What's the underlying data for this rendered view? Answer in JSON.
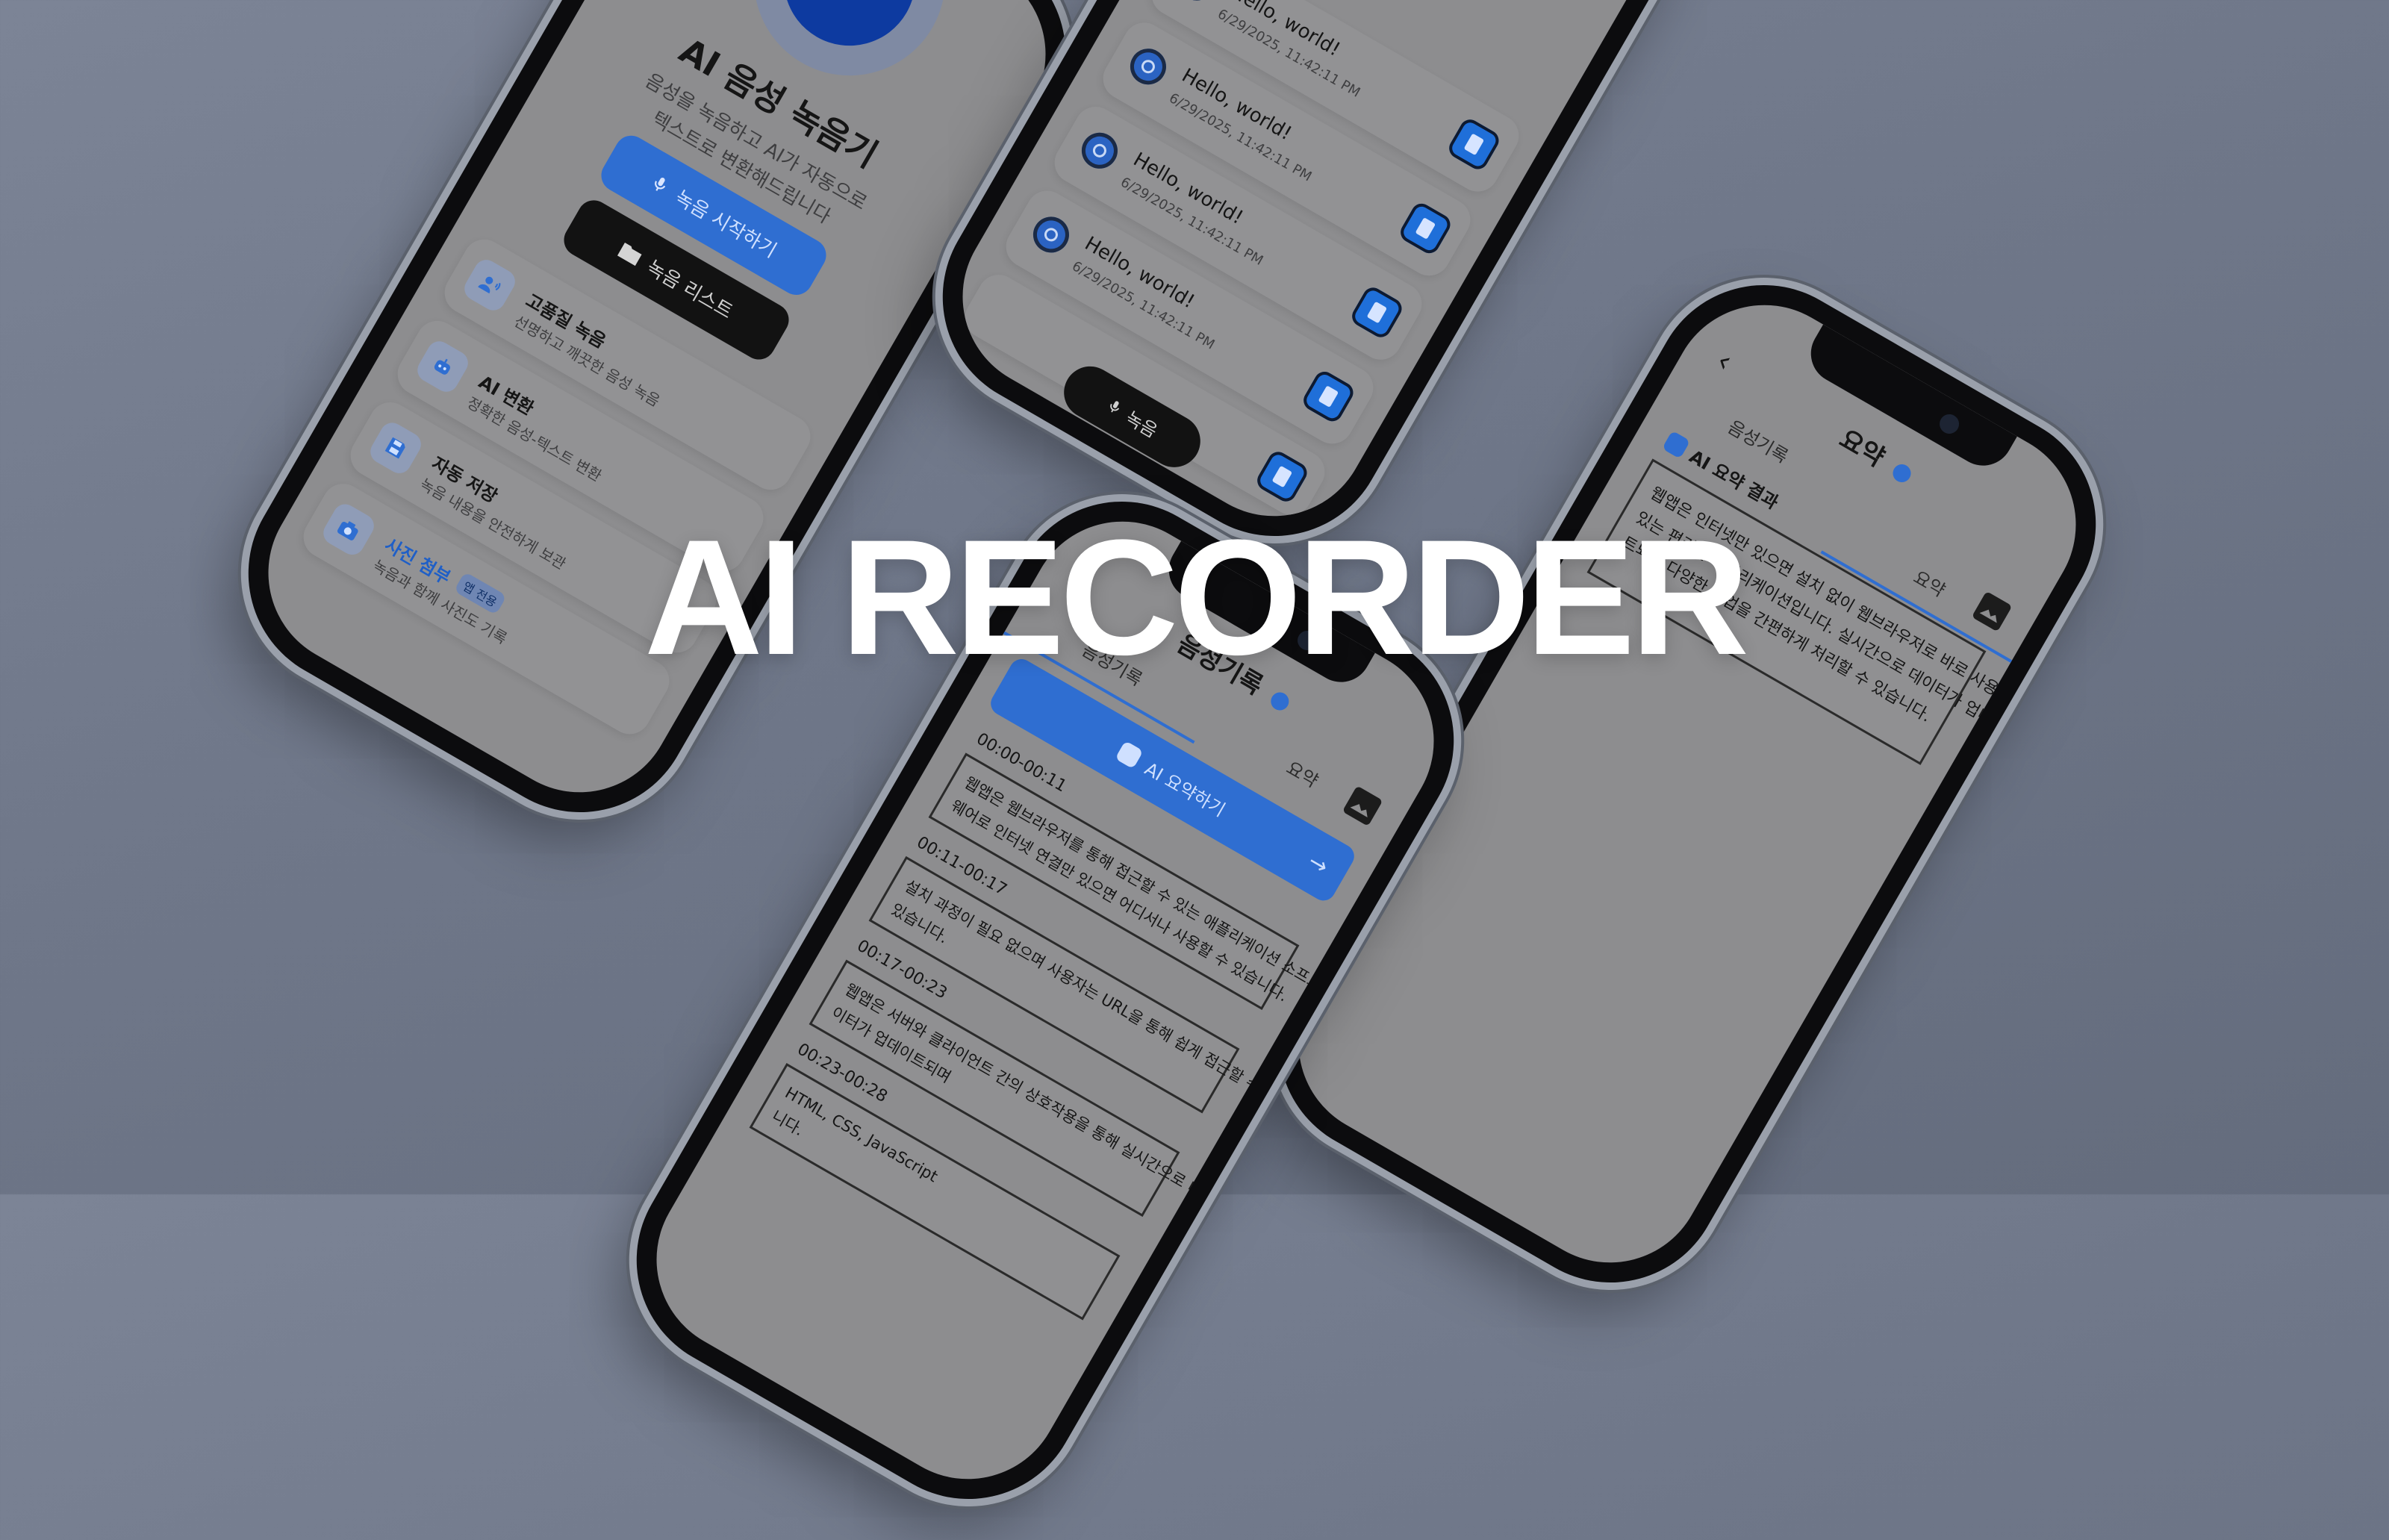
{
  "hero": {
    "title": "AI RECORDER"
  },
  "home": {
    "app_title": "AI 음성 녹음기",
    "subtitle_line1": "음성을 녹음하고 AI가 자동으로",
    "subtitle_line2": "텍스트로 변환해드립니다",
    "start_label": "녹음 시작하기",
    "list_label": "녹음 리스트",
    "features": [
      {
        "title": "고품질 녹음",
        "desc": "선명하고 깨끗한 음성 녹음",
        "icon": "person-voice-icon"
      },
      {
        "title": "AI 변환",
        "desc": "정확한 음성-텍스트 변환",
        "icon": "robot-icon"
      },
      {
        "title": "자동 저장",
        "desc": "녹음 내용을 안전하게 보관",
        "icon": "save-icon"
      },
      {
        "title": "사진 첨부",
        "badge": "앱 전용",
        "desc": "녹음과 함께 사진도 기록",
        "icon": "camera-icon"
      }
    ],
    "colors": {
      "accent": "#2f6ed1",
      "mic_circle": "#0d3aa0"
    }
  },
  "list": {
    "items": [
      {
        "title": "Hello, world!",
        "date": "6/29/2025, 11:42:11 PM"
      },
      {
        "title": "Hello, world!",
        "date": "6/29/2025, 11:42:11 PM"
      },
      {
        "title": "Hello, world!",
        "date": "6/29/2025, 11:42:11 PM"
      },
      {
        "title": "Hello, world!",
        "date": "6/29/2025, 11:42:11 PM"
      }
    ],
    "record_button_label": "녹음"
  },
  "transcript": {
    "header": "음성기록",
    "tabs": [
      "음성기록",
      "요약"
    ],
    "ai_summary_button": "AI 요약하기",
    "segments": [
      {
        "time": "00:00-00:11",
        "text_line1": "웹앱은 웹브라우저를 통해 접근할 수 있는 애플리케이션 소프트",
        "text_line2": "웨어로 인터넷 연결만 있으면 어디서나 사용할 수 있습니다."
      },
      {
        "time": "00:11-00:17",
        "text_line1": "설치 과정이 필요 없으며 사용자는 URL을 통해 쉽게 접근할 수",
        "text_line2": "있습니다."
      },
      {
        "time": "00:17-00:23",
        "text_line1": "웹앱은 서버와 클라이언트 간의 상호작용을 통해 실시간으로 데",
        "text_line2": "이터가 업데이트되며"
      },
      {
        "time": "00:23-00:28",
        "text_line1": "HTML, CSS, JavaScript",
        "text_line2": "니다."
      }
    ]
  },
  "summary": {
    "title": "요약",
    "tabs": [
      "음성기록",
      "요약"
    ],
    "result_label": "AI 요약 결과",
    "text_line1": "웹앱은 인터넷만 있으면 설치 없이 웹브라우저로 바로 사용할 수",
    "text_line2": "있는 편리한 애플리케이션입니다. 실시간으로 데이터가 업데이",
    "text_line3": "트되며 다양한 작업을 간편하게 처리할 수 있습니다."
  }
}
